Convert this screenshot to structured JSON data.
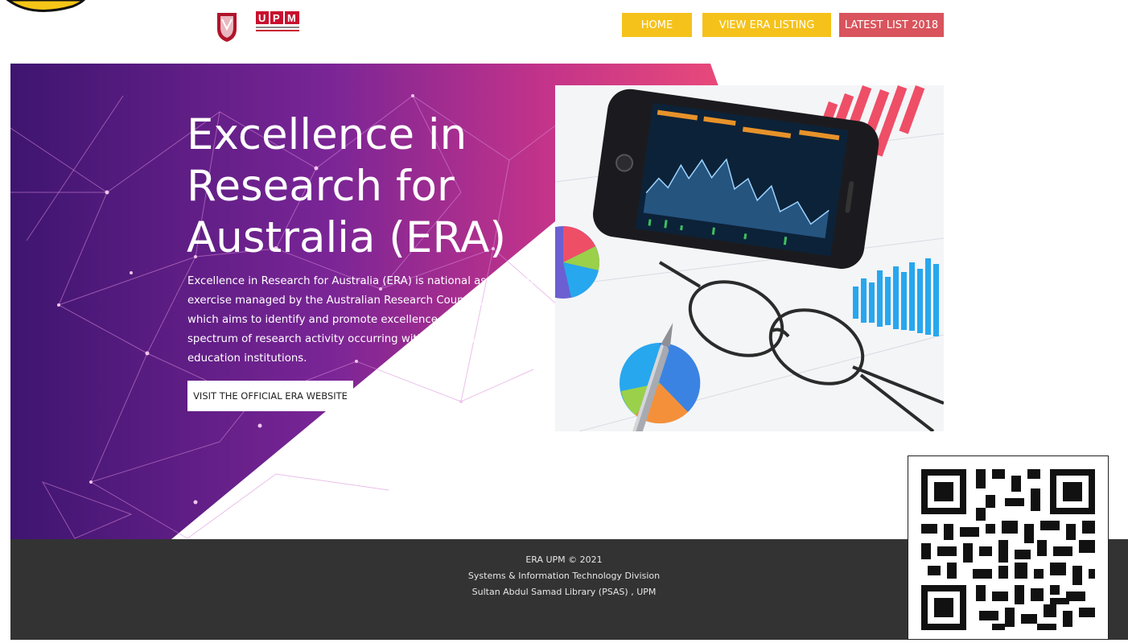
{
  "header": {
    "logo_text": "UPM",
    "nav": {
      "home": "HOME",
      "view_era_listing": "VIEW ERA LISTING",
      "latest_list": "LATEST LIST 2018"
    },
    "colors": {
      "nav_yellow": "#f5c21b",
      "nav_red": "#d9545c"
    }
  },
  "hero": {
    "title": "Excellence in Research for Australia (ERA)",
    "description": "Excellence in Research for Australia (ERA) is national assessment exercise managed by the Australian Research Council (ARC), which aims to identify and promote excellence across the full spectrum of research activity occurring within Australia's higher education institutions.",
    "button_label": "VISIT THE OFFICIAL ERA WEBSITE",
    "gradient": {
      "start": "#4b1a7a",
      "mid": "#8b2b9a",
      "end": "#e0407a"
    },
    "photo_icon": "smartphone-charts-glasses-photo"
  },
  "footer": {
    "line1": "ERA UPM © 2021",
    "line2": "Systems & Information Technology Division",
    "line3": "Sultan Abdul Samad Library  (PSAS) , UPM"
  },
  "qr_icon": "qr-code-icon"
}
